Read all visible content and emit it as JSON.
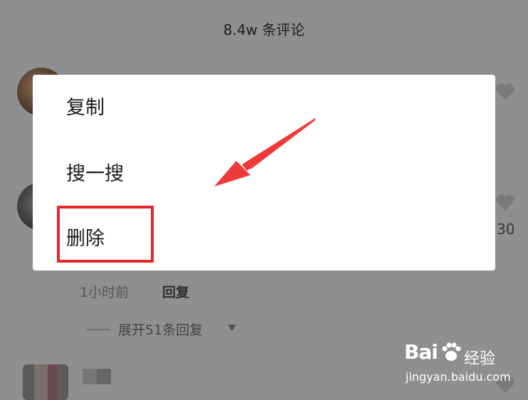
{
  "comments_sheet": {
    "title": "8.4w 条评论",
    "comment": {
      "time": "1小时前",
      "reply_label": "回复",
      "expand_label": "展开51条回复",
      "like_count_partial": "30"
    }
  },
  "context_menu": {
    "items": [
      {
        "label": "复制"
      },
      {
        "label": "搜一搜"
      },
      {
        "label": "删除"
      }
    ]
  },
  "annotation": {
    "highlight_color": "#e8272b",
    "highlighted_item": "删除"
  },
  "watermark": {
    "brand": "Bai",
    "brand_suffix": "经验",
    "url": "jingyan.baidu.com"
  }
}
